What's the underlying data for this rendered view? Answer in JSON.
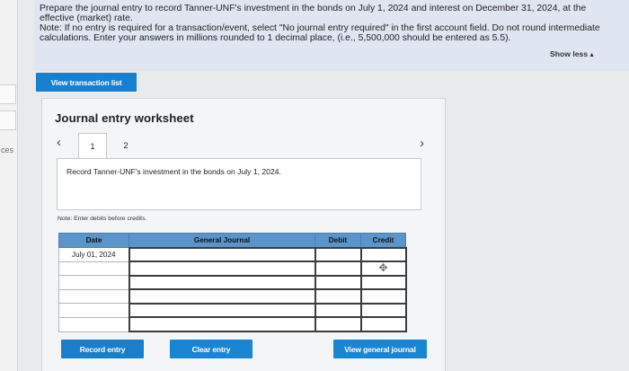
{
  "sidebar": {
    "label": "ces"
  },
  "instructions": {
    "line1": "Prepare the journal entry to record Tanner-UNF's investment in the bonds on July 1, 2024 and interest on December 31, 2024, at the effective (market) rate.",
    "line2": "Note: If no entry is required for a transaction/event, select \"No journal entry required\" in the first account field. Do not round intermediate calculations. Enter your answers in millions rounded to 1 decimal place, (i.e., 5,500,000 should be entered as 5.5).",
    "show_less": "Show less"
  },
  "buttons": {
    "view_transaction_list": "View transaction list",
    "record_entry": "Record entry",
    "clear_entry": "Clear entry",
    "view_general_journal": "View general journal"
  },
  "worksheet": {
    "title": "Journal entry worksheet",
    "tabs": [
      "1",
      "2"
    ],
    "active_tab": "1",
    "description": "Record Tanner-UNF's investment in the bonds on July 1, 2024.",
    "note": "Note: Enter debits before credits."
  },
  "table": {
    "headers": {
      "date": "Date",
      "general_journal": "General Journal",
      "debit": "Debit",
      "credit": "Credit"
    },
    "rows": [
      {
        "date": "July 01, 2024",
        "account": "",
        "debit": "",
        "credit": ""
      },
      {
        "date": "",
        "account": "",
        "debit": "",
        "credit": ""
      },
      {
        "date": "",
        "account": "",
        "debit": "",
        "credit": ""
      },
      {
        "date": "",
        "account": "",
        "debit": "",
        "credit": ""
      },
      {
        "date": "",
        "account": "",
        "debit": "",
        "credit": ""
      },
      {
        "date": "",
        "account": "",
        "debit": "",
        "credit": ""
      }
    ]
  },
  "colors": {
    "button_blue": "#1a85d2",
    "header_blue": "#5b94c8",
    "panel_bg": "#dfe6f1"
  }
}
